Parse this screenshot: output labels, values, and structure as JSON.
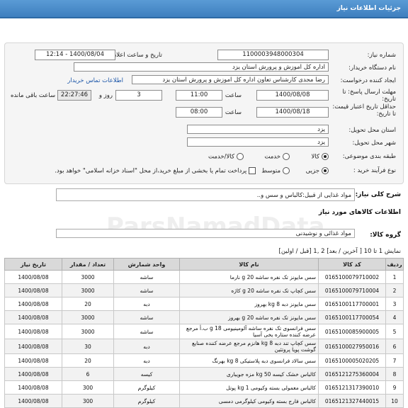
{
  "header": {
    "title": "جزئیات اطلاعات نیاز"
  },
  "form": {
    "need_number_label": "شماره نیاز:",
    "need_number": "1100003948000304",
    "announce_label": "تاریخ و ساعت اعلان عمومی:",
    "announce_value": "1400/08/04 - 12:14",
    "buyer_org_label": "نام دستگاه خریدار:",
    "buyer_org": "اداره کل اموزش و پرورش استان یزد",
    "creator_label": "ایجاد کننده درخواست:",
    "creator": "رضا مجدی کارشناس تعاون اداره کل اموزش و پرورش استان یزد",
    "contact_link": "اطلاعات تماس خریدار",
    "deadline_label": "مهلت ارسال پاسخ: تا تاریخ:",
    "deadline_date": "1400/08/08",
    "time_label": "ساعت",
    "deadline_time": "11:00",
    "days_value": "3",
    "days_label": "روز و",
    "remaining_time": "22:27:46",
    "remaining_label": "ساعت باقی مانده",
    "min_validity_label": "حداقل تاریخ اعتبار قیمت: تا تاریخ:",
    "validity_date": "1400/08/18",
    "validity_time_label": "ساعت",
    "validity_time": "08:00",
    "province_label": "استان محل تحویل:",
    "province": "یزد",
    "city_label": "شهر محل تحویل:",
    "city": "یزد",
    "category_label": "طبقه بندی موضوعی:",
    "category_options": [
      "کالا",
      "خدمت",
      "کالا/خدمت"
    ],
    "category_selected": "کالا",
    "process_label": "نوع فرآیند خرید :",
    "process_options": [
      "جزیی",
      "متوسط"
    ],
    "process_selected": "جزیی",
    "treasury_note": "پرداخت تمام یا بخشی از مبلغ خرید،از محل \"اسناد خزانه اسلامی\" خواهد بود."
  },
  "description": {
    "label": "شرح کلی نیاز:",
    "value": "مواد غذایی از قبیل:کالباس و سس و.."
  },
  "goods": {
    "section_title": "اطلاعات کالاهای مورد نیاز",
    "group_label": "گروه کالا:",
    "group_value": "مواد غذائی و نوشیدنی"
  },
  "pagination": {
    "text": "نمایش 1 تا 10 [ آخرین / بعد] 2 ,1 [قبل / اولین]"
  },
  "table": {
    "headers": [
      "ردیف",
      "کد کالا",
      "نام کالا",
      "واحد شمارش",
      "تعداد / مقدار",
      "تاریخ نیاز"
    ],
    "rows": [
      [
        "1",
        "0165100079710002",
        "سس مایونز تک نفره ساشه 20 g نارما",
        "ساشه",
        "3000",
        "1400/08/08"
      ],
      [
        "2",
        "0165100079710004",
        "سس کچاپ تک نفره ساشه 20 g کاژه",
        "ساشه",
        "3000",
        "1400/08/08"
      ],
      [
        "3",
        "0165100117700001",
        "سس مایونز دبه 8 kg بهروز",
        "دبه",
        "20",
        "1400/08/08"
      ],
      [
        "4",
        "0165100117700054",
        "سس مایونز تک نفره ساشه 20 g بهروز",
        "ساشه",
        "3000",
        "1400/08/08"
      ],
      [
        "5",
        "0165100085900005",
        "سس فرانسوی تک نفره ساشه آلومینیومی 18 g ب.أ مرجع عرضه کننده ستاره یخی آسیا",
        "ساشه",
        "3000",
        "1400/08/08"
      ],
      [
        "6",
        "0165100027950016",
        "سس کچاپ تند دبه 8 kg هانزم مرجع عرضه کننده صنایع گوشت پویا پروتئین",
        "دبه",
        "30",
        "1400/08/08"
      ],
      [
        "7",
        "0165100005020205",
        "سس سالاد فرانسوی دبه پلاستیکی 8 kg بهرنگ",
        "دبه",
        "20",
        "1400/08/08"
      ],
      [
        "8",
        "0165121275360004",
        "کالباس خشک کیسه 50 kg مزه جویباری",
        "کیسه",
        "6",
        "1400/08/08"
      ],
      [
        "9",
        "0165121317390010",
        "کالباس معمولی بسته وکیومی 1 kg پوتل",
        "کیلوگرم",
        "300",
        "1400/08/08"
      ],
      [
        "10",
        "0165121327440015",
        "کالباس فارج بسته وکیومی کیلوگرمی دمسی",
        "کیلوگرم",
        "300",
        "1400/08/08"
      ]
    ]
  }
}
